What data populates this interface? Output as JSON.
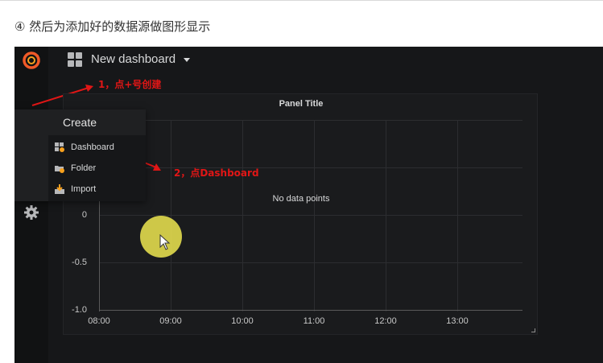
{
  "caption": {
    "circled_number": "④",
    "text": "然后为添加好的数据源做图形显示"
  },
  "topbar": {
    "dashboard_title": "New dashboard"
  },
  "annotations": {
    "step1": "1，点+号创建",
    "step2": "2，点Dashboard"
  },
  "create_menu": {
    "header": "Create",
    "items": [
      {
        "label": "Dashboard",
        "icon": "dashboard-new-icon"
      },
      {
        "label": "Folder",
        "icon": "folder-new-icon"
      },
      {
        "label": "Import",
        "icon": "import-icon"
      }
    ]
  },
  "sidebar": {
    "items": [
      {
        "icon": "grafana-logo-icon"
      },
      {
        "icon": "plus-icon"
      },
      {
        "icon": "dashboards-grid-icon"
      },
      {
        "icon": "bell-icon"
      },
      {
        "icon": "gear-icon"
      }
    ]
  },
  "panel": {
    "title": "Panel Title",
    "empty_message": "No data points"
  },
  "chart_data": {
    "type": "line",
    "title": "Panel Title",
    "x_ticks": [
      "08:00",
      "09:00",
      "10:00",
      "11:00",
      "12:00",
      "13:00"
    ],
    "y_ticks_visible": [
      "0",
      "-0.5",
      "-1.0"
    ],
    "ylim": [
      -1.0,
      1.0
    ],
    "series": [],
    "grid": true,
    "annotation": "No data points"
  },
  "colors": {
    "background": "#161719",
    "sidebar": "#111213",
    "accent_logo": "#f05a28",
    "annotation_red": "#e01616",
    "cursor_highlight": "#eee650"
  }
}
